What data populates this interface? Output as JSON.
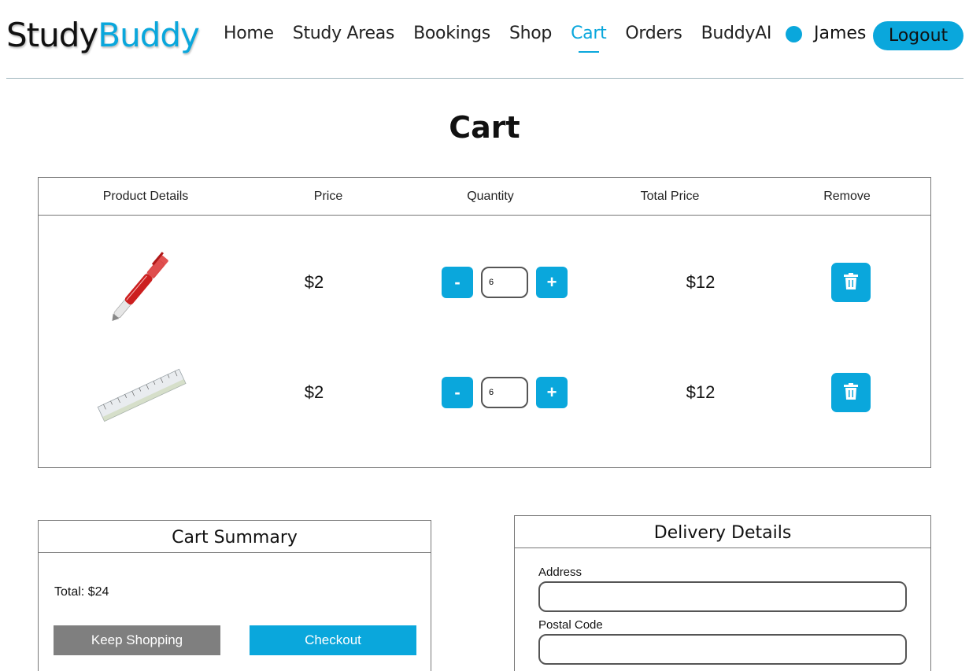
{
  "header": {
    "logo_part1": "Study",
    "logo_part2": "Buddy",
    "nav": [
      "Home",
      "Study Areas",
      "Bookings",
      "Shop",
      "Cart",
      "Orders",
      "BuddyAI"
    ],
    "active_nav": "Cart",
    "user_name": "James",
    "logout_label": "Logout",
    "accent_color": "#0aa7dc"
  },
  "page_title": "Cart",
  "cart": {
    "columns": [
      "Product Details",
      "Price",
      "Quantity",
      "Total Price",
      "Remove"
    ],
    "items": [
      {
        "product": "red-pen",
        "price": "$2",
        "quantity": "6",
        "total": "$12",
        "minus_label": "-",
        "plus_label": "+"
      },
      {
        "product": "ruler",
        "price": "$2",
        "quantity": "6",
        "total": "$12",
        "minus_label": "-",
        "plus_label": "+"
      }
    ]
  },
  "summary": {
    "title": "Cart Summary",
    "total_text": "Total: $24",
    "keep_shopping_label": "Keep Shopping",
    "checkout_label": "Checkout"
  },
  "delivery": {
    "title": "Delivery Details",
    "address_label": "Address",
    "address_value": "",
    "postal_label": "Postal Code",
    "postal_value": ""
  }
}
